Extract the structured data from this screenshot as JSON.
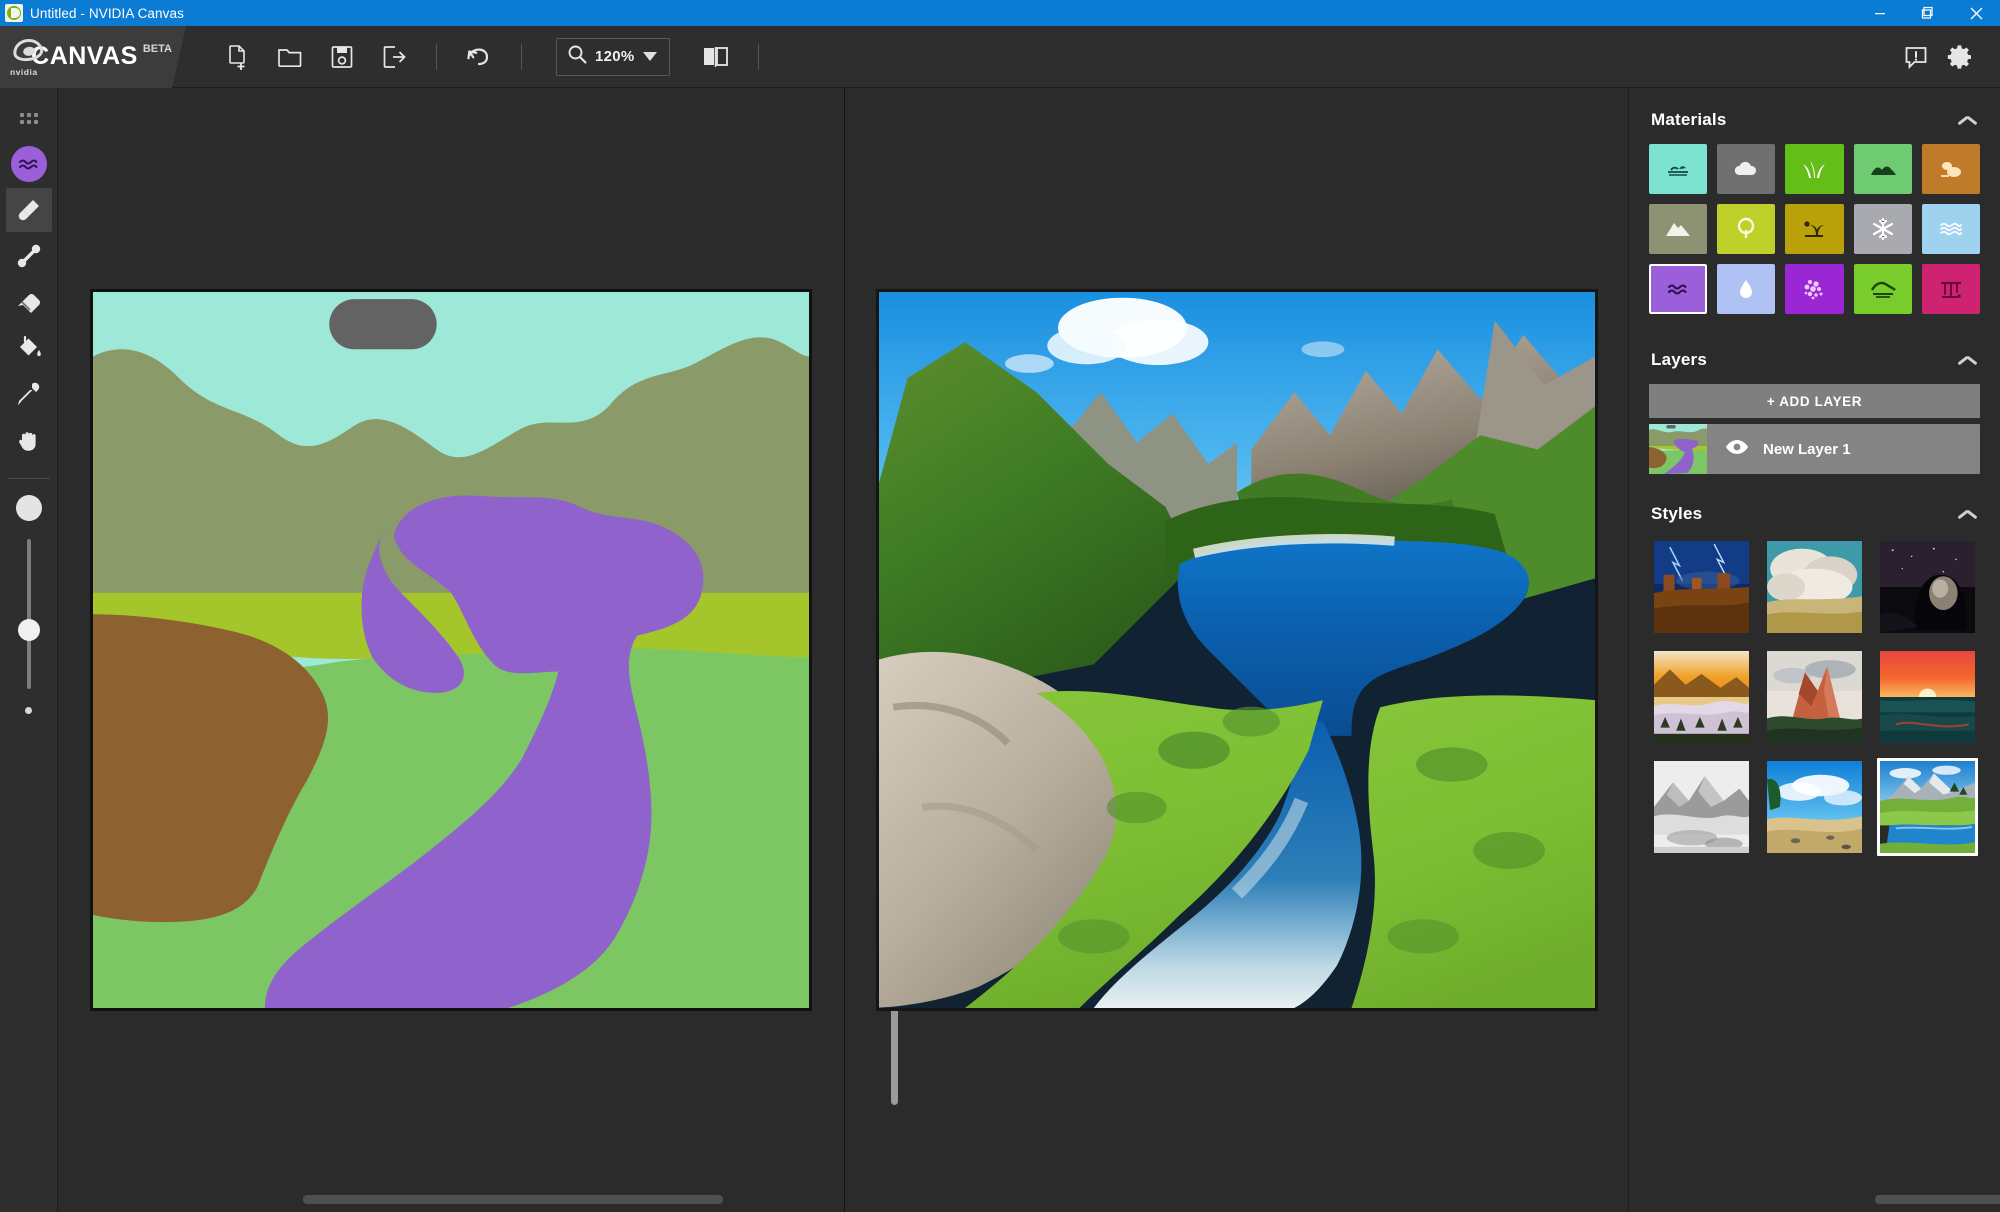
{
  "window": {
    "title": "Untitled - NVIDIA Canvas",
    "app_icon": "nvidia-canvas-icon",
    "minimize_label": "Minimize",
    "maximize_label": "Restore",
    "close_label": "Close",
    "titlebar_color": "#0b7cd4"
  },
  "brand": {
    "logo": "nvidia-logo",
    "name": "CANVAS",
    "tag": "BETA"
  },
  "toolbar": {
    "new_label": "New",
    "open_label": "Open",
    "save_label": "Save",
    "export_label": "Export",
    "undo_label": "Undo",
    "zoom_icon": "magnifier-icon",
    "zoom_value": "120%",
    "zoom_caret": "caret-down-icon",
    "view_toggle_label": "Side by side view",
    "feedback_label": "Feedback",
    "settings_label": "Settings"
  },
  "tools": {
    "items": [
      {
        "name": "materials-grid-toggle",
        "icon": "grid-dots-icon",
        "label": "Materials",
        "active": false
      },
      {
        "name": "current-material",
        "icon": "water-swatch-icon",
        "label": "Water",
        "active": false,
        "color": "#9B5FD9"
      },
      {
        "name": "brush",
        "icon": "paintbrush-icon",
        "label": "Paintbrush",
        "active": true
      },
      {
        "name": "line",
        "icon": "line-tool-icon",
        "label": "Line",
        "active": false
      },
      {
        "name": "eraser",
        "icon": "eraser-icon",
        "label": "Eraser",
        "active": false
      },
      {
        "name": "fill",
        "icon": "paint-bucket-icon",
        "label": "Fill",
        "active": false
      },
      {
        "name": "eyedropper",
        "icon": "eyedropper-icon",
        "label": "Eyedropper",
        "active": false
      },
      {
        "name": "pan",
        "icon": "hand-icon",
        "label": "Pan",
        "active": false
      }
    ],
    "brush_size_max_label": "Large brush",
    "brush_size_min_label": "Small brush",
    "brush_size_slider_label": "Brush size"
  },
  "canvas": {
    "left_pane_label": "Segmentation sketch",
    "right_pane_label": "Generated image",
    "sketch_colors": {
      "sky": "#9DE8D7",
      "cloud": "#636363",
      "mountain": "#8A9A68",
      "grass_band": "#A5C62B",
      "grass": "#7CC764",
      "dirt": "#8E6230",
      "water": "#8F62CC"
    }
  },
  "materials": {
    "title": "Materials",
    "collapse_icon": "chevron-up-icon",
    "items": [
      {
        "name": "material-sea",
        "label": "Sea",
        "bg": "#7BE3CF",
        "fg": "#134a3f",
        "icon": "sea-icon",
        "selected": false
      },
      {
        "name": "material-cloud",
        "label": "Cloud",
        "bg": "#707070",
        "fg": "#efefef",
        "icon": "cloud-icon",
        "selected": false
      },
      {
        "name": "material-grass",
        "label": "Grass",
        "bg": "#63BE18",
        "fg": "#ffffff",
        "icon": "grass-icon",
        "selected": false
      },
      {
        "name": "material-hill",
        "label": "Hill",
        "bg": "#6FCB72",
        "fg": "#16401d",
        "icon": "hill-icon",
        "selected": false
      },
      {
        "name": "material-sand",
        "label": "Sand",
        "bg": "#BF7B2A",
        "fg": "#ffe3bb",
        "icon": "sand-icon",
        "selected": false
      },
      {
        "name": "material-mountain",
        "label": "Mountain",
        "bg": "#8D9272",
        "fg": "#f2f2ea",
        "icon": "mountain-icon",
        "selected": false
      },
      {
        "name": "material-bush",
        "label": "Bush",
        "bg": "#BFD02B",
        "fg": "#f6fbe0",
        "icon": "bush-icon",
        "selected": false
      },
      {
        "name": "material-desert",
        "label": "Desert",
        "bg": "#B9A109",
        "fg": "#2d2600",
        "icon": "desert-icon",
        "selected": false
      },
      {
        "name": "material-snow",
        "label": "Snow",
        "bg": "#A8AAB0",
        "fg": "#ffffff",
        "icon": "snowflake-icon",
        "selected": false
      },
      {
        "name": "material-water",
        "label": "Water",
        "bg": "#9ED2EE",
        "fg": "#ffffff",
        "icon": "waves-icon",
        "selected": false
      },
      {
        "name": "material-river",
        "label": "River",
        "bg": "#9B5FD9",
        "fg": "#2a0d4d",
        "icon": "river-icon",
        "selected": true
      },
      {
        "name": "material-fog",
        "label": "Fog",
        "bg": "#AFC2F3",
        "fg": "#ffffff",
        "icon": "droplet-icon",
        "selected": false
      },
      {
        "name": "material-flowers",
        "label": "Flowers",
        "bg": "#9B27D4",
        "fg": "#f0c9ff",
        "icon": "flowers-icon",
        "selected": false
      },
      {
        "name": "material-ground",
        "label": "Ground",
        "bg": "#78CC2B",
        "fg": "#1f4208",
        "icon": "ground-icon",
        "selected": false
      },
      {
        "name": "material-ruins",
        "label": "Ruins",
        "bg": "#CE2371",
        "fg": "#6b0b35",
        "icon": "ruins-icon",
        "selected": false
      }
    ]
  },
  "layers": {
    "title": "Layers",
    "collapse_icon": "chevron-up-icon",
    "add_label": "+ ADD LAYER",
    "items": [
      {
        "name": "layer-new-layer-1",
        "label": "New Layer 1",
        "visible": true,
        "visibility_icon": "eye-icon"
      }
    ]
  },
  "styles": {
    "title": "Styles",
    "collapse_icon": "chevron-up-icon",
    "items": [
      {
        "name": "style-desert-storm",
        "label": "Desert Storm",
        "selected": false
      },
      {
        "name": "style-cloudscape",
        "label": "Cloudscape",
        "selected": false
      },
      {
        "name": "style-night-cave",
        "label": "Night Cave",
        "selected": false
      },
      {
        "name": "style-golden-fog",
        "label": "Golden Fog",
        "selected": false
      },
      {
        "name": "style-red-peaks",
        "label": "Red Peaks",
        "selected": false
      },
      {
        "name": "style-ocean-sunset",
        "label": "Ocean Sunset",
        "selected": false
      },
      {
        "name": "style-misty-mono",
        "label": "Misty Mono",
        "selected": false
      },
      {
        "name": "style-blue-shore",
        "label": "Blue Shore",
        "selected": false
      },
      {
        "name": "style-alpine-lake",
        "label": "Alpine Lake",
        "selected": true
      }
    ]
  }
}
